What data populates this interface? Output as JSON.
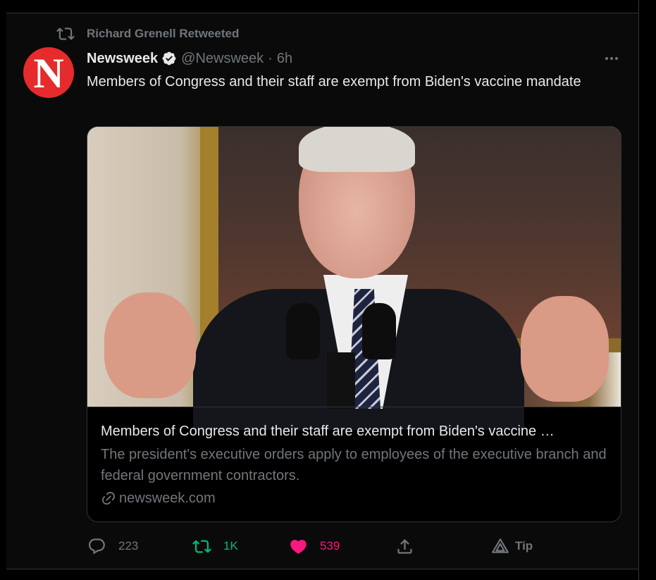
{
  "retweet_context": {
    "label": "Richard Grenell Retweeted",
    "icon": "retweet-icon"
  },
  "author": {
    "avatar_letter": "N",
    "avatar_color": "#e52b2b",
    "name": "Newsweek",
    "verified": true,
    "handle": "@Newsweek",
    "separator": "·",
    "time": "6h"
  },
  "tweet": {
    "text": "Members of Congress and their staff are exempt from Biden's vaccine mandate"
  },
  "card": {
    "title": "Members of Congress and their staff are exempt from Biden's vaccine …",
    "description": "The president's executive orders apply to employees of the executive branch and federal government contractors.",
    "domain": "newsweek.com",
    "domain_icon": "link-icon"
  },
  "actions": {
    "reply": {
      "icon": "reply-icon",
      "count": "223"
    },
    "retweet": {
      "icon": "retweet-icon",
      "count": "1K",
      "color": "#00ba7c"
    },
    "like": {
      "icon": "heart-icon",
      "count": "539",
      "color": "#f91880"
    },
    "share": {
      "icon": "share-icon"
    },
    "tip": {
      "icon": "tip-icon",
      "label": "Tip"
    }
  },
  "colors": {
    "background": "#000000",
    "text_primary": "#e7e9ea",
    "text_secondary": "#71767b",
    "border": "#2f3336",
    "verified": "#e7e9ea"
  }
}
